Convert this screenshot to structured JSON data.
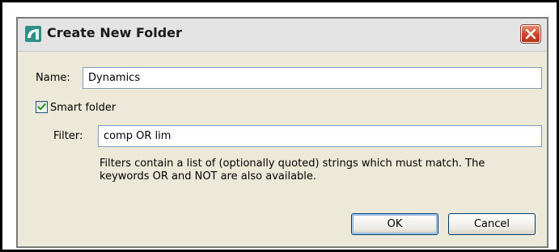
{
  "window": {
    "title": "Create New Folder",
    "close_icon": "close-icon"
  },
  "form": {
    "name_label": "Name:",
    "name_value": "Dynamics",
    "smart_folder_label": "Smart folder",
    "smart_folder_checked": true,
    "filter_label": "Filter:",
    "filter_value": "comp OR lim",
    "help_text": "Filters contain a list of (optionally quoted) strings which must match. The keywords OR and NOT are also available."
  },
  "buttons": {
    "ok_label": "OK",
    "cancel_label": "Cancel"
  },
  "colors": {
    "dialog_background": "#ece9d8",
    "close_button": "#c8452c",
    "checkmark": "#21a121",
    "field_border": "#7f9db9"
  }
}
